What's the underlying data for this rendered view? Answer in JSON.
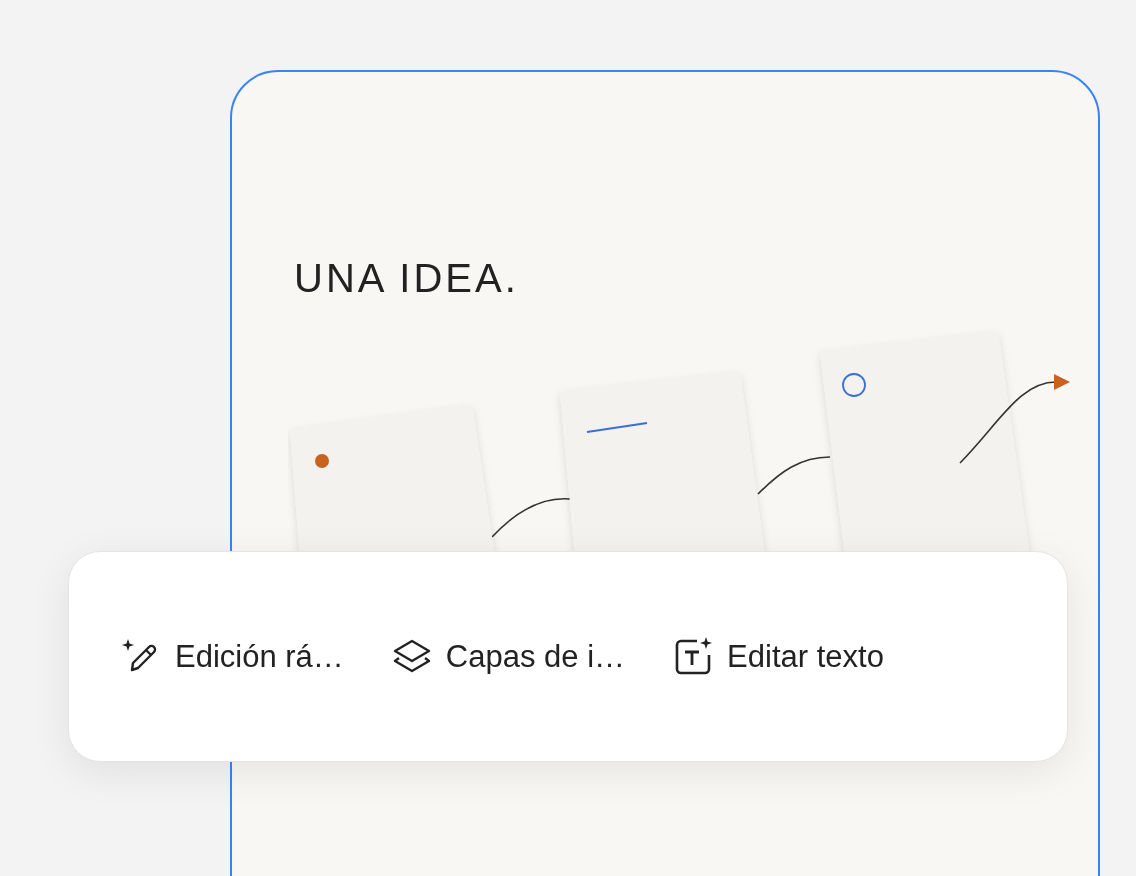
{
  "canvas": {
    "title": "UNA IDEA.",
    "selected": true
  },
  "toolbar": {
    "items": [
      {
        "kind": "magic-edit",
        "label": "Edición rá…"
      },
      {
        "kind": "layers",
        "label": "Capas de i…"
      },
      {
        "kind": "edit-text",
        "label": "Editar texto"
      }
    ]
  }
}
